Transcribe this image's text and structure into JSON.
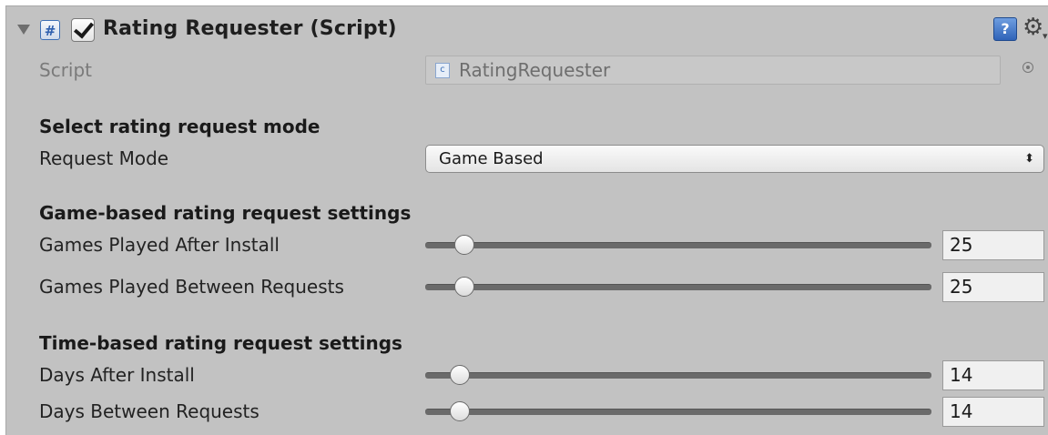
{
  "component": {
    "title": "Rating Requester (Script)",
    "enabled": true
  },
  "script_row": {
    "label": "Script",
    "value": "RatingRequester"
  },
  "mode_section": {
    "heading": "Select rating request mode",
    "request_mode": {
      "label": "Request Mode",
      "value": "Game Based"
    }
  },
  "game_section": {
    "heading": "Game-based rating request settings",
    "fields": [
      {
        "label": "Games Played After Install",
        "value": "25",
        "slider_fraction": 0.06
      },
      {
        "label": "Games Played Between Requests",
        "value": "25",
        "slider_fraction": 0.06
      }
    ]
  },
  "time_section": {
    "heading": "Time-based rating request settings",
    "fields": [
      {
        "label": "Days After Install",
        "value": "14",
        "slider_fraction": 0.05
      },
      {
        "label": "Days Between Requests",
        "value": "14",
        "slider_fraction": 0.05
      }
    ]
  },
  "icons": {
    "foldout": "foldout-arrow-icon",
    "script": "csharp-script-icon",
    "help": "help-icon",
    "settings": "gear-icon",
    "object_picker": "object-picker-icon"
  }
}
